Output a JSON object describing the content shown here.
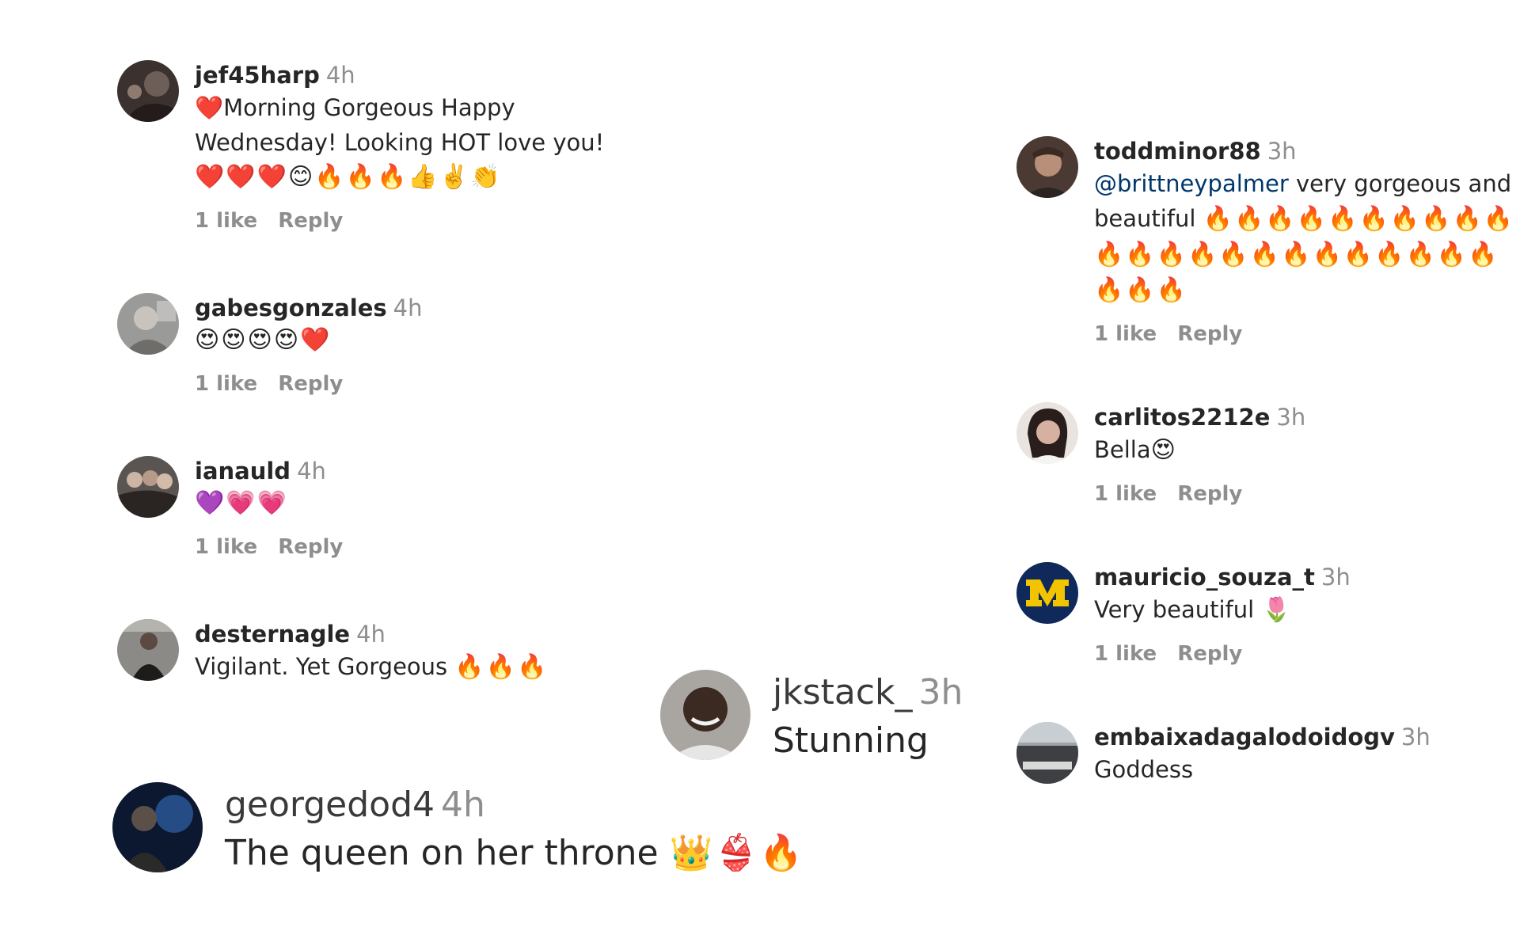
{
  "comments_left": [
    {
      "username": "jef45harp",
      "time": "4h",
      "text": "❤️Morning Gorgeous Happy Wednesday! Looking HOT love you!",
      "emojis": "❤️❤️❤️😊🔥🔥🔥👍✌️👏",
      "likes": "1 like",
      "reply": "Reply"
    },
    {
      "username": "gabesgonzales",
      "time": "4h",
      "text": "",
      "emojis": "😍😍😍😍❤️",
      "likes": "1 like",
      "reply": "Reply"
    },
    {
      "username": "ianauld",
      "time": "4h",
      "text": "",
      "emojis": "💜💗💗",
      "likes": "1 like",
      "reply": "Reply"
    },
    {
      "username": "desternagle",
      "time": "4h",
      "text": "Vigilant. Yet Gorgeous ",
      "emojis": "🔥🔥🔥"
    }
  ],
  "comments_right": [
    {
      "username": "toddminor88",
      "time": "3h",
      "mention": "@brittneypalmer",
      "text": " very gorgeous and beautiful ",
      "emojis": "🔥🔥🔥🔥🔥🔥🔥🔥🔥🔥🔥🔥🔥🔥🔥🔥🔥🔥🔥🔥🔥🔥🔥🔥🔥🔥",
      "likes": "1 like",
      "reply": "Reply"
    },
    {
      "username": "carlitos2212e",
      "time": "3h",
      "text": "Bella",
      "emojis": "😍",
      "likes": "1 like",
      "reply": "Reply"
    },
    {
      "username": "mauricio_souza_t",
      "time": "3h",
      "text": "Very beautiful ",
      "emojis": "🌷",
      "likes": "1 like",
      "reply": "Reply"
    },
    {
      "username": "embaixadagalodoidogv",
      "time": "3h",
      "text": "Goddess"
    }
  ],
  "comments_zoomed": [
    {
      "username": "jkstack_",
      "time": "3h",
      "text": "Stunning"
    },
    {
      "username": "georgedod4",
      "time": "4h",
      "text": "The queen on her throne ",
      "emojis": "👑👙🔥"
    }
  ],
  "colors": {
    "username": "#262626",
    "meta": "#8e8e8e",
    "mention": "#00376b"
  }
}
